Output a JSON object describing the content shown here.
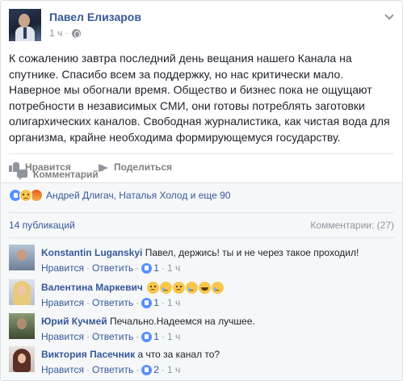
{
  "post": {
    "author": "Павел Елизаров",
    "time": "1 ч",
    "separator": "·",
    "text": "К сожалению завтра последний день вещания нашего Канала на спутнике. Спасибо всем за поддержку, но нас критически мало. Наверное мы обогнали время. Общество и бизнес пока не ощущают потребности в независимых СМИ, они готовы потреблять заготовки олигархических каналов. Свободная журналистика, как чистая вода для организма, крайне необходима формирующемуся государству."
  },
  "actions": {
    "like_label": "Нравится",
    "comment_label": "Комментарий",
    "share_label": "Поделиться"
  },
  "reactions": {
    "icons": [
      "like-icon",
      "sad-icon",
      "angry-icon"
    ],
    "summary": "Андрей Длигач, Наталья Холод и еще 90"
  },
  "stats": {
    "shares": "14 публикаций",
    "comments": "Комментарии: (27)"
  },
  "comment_actions": {
    "like": "Нравится",
    "reply": "Ответить",
    "dot": "·"
  },
  "comments": [
    {
      "name": "Konstantin Luganskyi",
      "text": "Павел, держись! ты и не через такое проходил!",
      "likes": "1",
      "time": "1 ч",
      "emoji": []
    },
    {
      "name": "Валентина Маркевич",
      "text": "",
      "likes": "1",
      "time": "1 ч",
      "emoji": [
        "sad-icon",
        "tear-icon",
        "sad-icon",
        "tear-icon",
        "laugh-icon",
        "tear-icon"
      ]
    },
    {
      "name": "Юрий Кучмей",
      "text": "Печально.Надеемся на лучшее.",
      "likes": "1",
      "time": "1 ч",
      "emoji": []
    },
    {
      "name": "Виктория Пасечник",
      "text": "а что за канал то?",
      "likes": "2",
      "time": "1 ч",
      "emoji": []
    }
  ],
  "colors": {
    "link": "#365899",
    "muted": "#90949c",
    "panel": "#f6f7f9"
  }
}
